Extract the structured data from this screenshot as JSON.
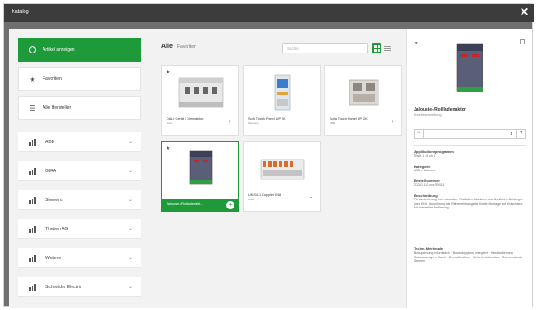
{
  "window": {
    "title": "Katalog",
    "close_glyph": "✕"
  },
  "sidebar": {
    "primary_label": "Artikel anzeigen",
    "favorites_label": "Favoriten",
    "all_makers_label": "Alle Hersteller",
    "categories": [
      {
        "label": "ABB"
      },
      {
        "label": "GIRA"
      },
      {
        "label": "Siemens"
      },
      {
        "label": "Theben AG"
      },
      {
        "label": "Weitere"
      },
      {
        "label": "Schneider Electric"
      }
    ]
  },
  "toolbar": {
    "tab_all": "Alle",
    "tab_favorites": "Favoriten",
    "search_placeholder": "Suche"
  },
  "products": [
    {
      "name": "DALI Gerät / Dimmaktor",
      "maker": "Gira"
    },
    {
      "name": "Sofa Touch Panel UP 2K",
      "maker": "Siemens"
    },
    {
      "name": "Sofa Touch Panel UP 2K",
      "maker": "ABB"
    },
    {
      "name": "Jalousie-/Rollladenakt...",
      "maker": "ABB"
    },
    {
      "name": "UK/S4.1 Kopplen IN8",
      "maker": "ABB"
    }
  ],
  "detail": {
    "title": "Jalousie-/Rollladenaktor",
    "subtitle": "Kurzbeschreibung",
    "quantity": "1",
    "sections": [
      {
        "heading": "Applikationsprogramm",
        "value": "Shutt 1 - 6 ch 1"
      },
      {
        "heading": "Kategorie",
        "value": "ABB > Aktoren"
      },
      {
        "heading": "Bestellnummer",
        "value": "2CDG 110 xxx R0011"
      },
      {
        "heading": "Beschreibung",
        "value": "Für Ansteuerung von Jalousien, Rollläden, Markisen und ähnlichen Behängen über KNX. Ausführung als Reiheneinbaugerät für die Montage auf Hutschiene. Mit manueller Bedienung."
      },
      {
        "heading": "Techn. Merkmale",
        "value": "Busspannung erforderlich · Busankopplung integriert · Handbedienung · Statusanzeige je Kanal · Zentralfunktion · Sicherheitsfunktion · Sonnenschutz · Szenen"
      }
    ]
  },
  "colors": {
    "accent": "#1f9a3b",
    "titlebar": "#3c3c3c",
    "frame": "#6f6f6f"
  },
  "icons": [
    "checkmark-circle-icon",
    "star-icon",
    "list-icon",
    "category-bars-icon",
    "chevron-down-icon",
    "search-icon",
    "grid-view-icon",
    "list-view-icon",
    "plus-icon",
    "expand-icon",
    "close-icon"
  ]
}
